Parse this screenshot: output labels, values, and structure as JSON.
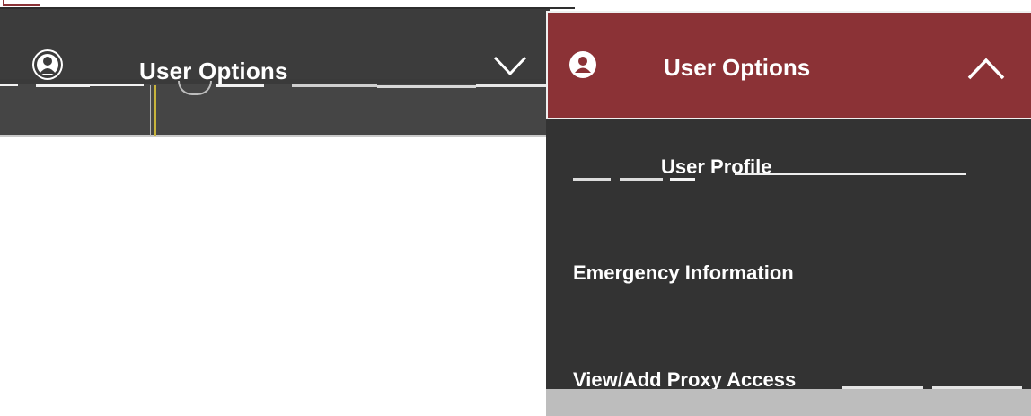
{
  "collapsed_menu": {
    "title": "User Options",
    "toggle_icon": "chevron-down-icon",
    "avatar_icon": "user-icon"
  },
  "expanded_menu": {
    "title": "User Options",
    "toggle_icon": "chevron-up-icon",
    "avatar_icon": "user-icon",
    "items": [
      {
        "label": "User Profile"
      },
      {
        "label": "Emergency Information"
      },
      {
        "label": "View/Add Proxy Access"
      }
    ]
  },
  "colors": {
    "header_accent": "#8b3236",
    "menu_background": "#333333",
    "text": "#ffffff"
  }
}
